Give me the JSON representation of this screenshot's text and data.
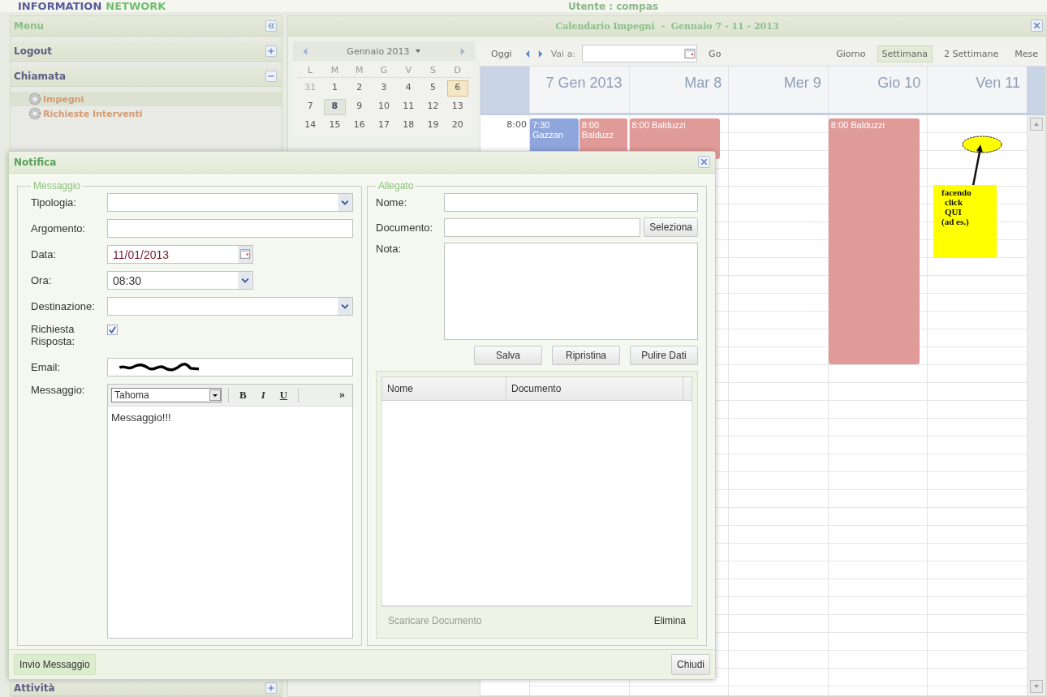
{
  "header": {
    "brand": "INFORMATION",
    "brand_accent": "NETWORK",
    "user": "Utente : compas"
  },
  "sidebar": {
    "title": "Menu",
    "sections": [
      {
        "label": "Logout",
        "expanded": false
      },
      {
        "label": "Chiamata",
        "expanded": true,
        "items": [
          {
            "label": "Impegni",
            "selected": true
          },
          {
            "label": "Richieste Interventi",
            "selected": false
          }
        ]
      }
    ],
    "bottom_section": {
      "label": "Attività",
      "expanded": false
    }
  },
  "calendar": {
    "title": "Calendario Impegni  -  Gennaio 7 - 11 - 2013",
    "mini": {
      "month": "Gennaio 2013",
      "weekdays": [
        "L",
        "M",
        "M",
        "G",
        "V",
        "S",
        "D"
      ],
      "weeks": [
        [
          {
            "d": "31",
            "muted": true,
            "today": false,
            "selected": false
          },
          {
            "d": "1",
            "muted": false,
            "today": false,
            "selected": false
          },
          {
            "d": "2",
            "muted": false,
            "today": false,
            "selected": false
          },
          {
            "d": "3",
            "muted": false,
            "today": false,
            "selected": false
          },
          {
            "d": "4",
            "muted": false,
            "today": false,
            "selected": false
          },
          {
            "d": "5",
            "muted": false,
            "today": false,
            "selected": false
          },
          {
            "d": "6",
            "muted": false,
            "today": true,
            "selected": false
          }
        ],
        [
          {
            "d": "7",
            "muted": false,
            "today": false,
            "selected": false
          },
          {
            "d": "8",
            "muted": false,
            "today": false,
            "selected": true
          },
          {
            "d": "9",
            "muted": false,
            "today": false,
            "selected": false
          },
          {
            "d": "10",
            "muted": false,
            "today": false,
            "selected": false
          },
          {
            "d": "11",
            "muted": false,
            "today": false,
            "selected": false
          },
          {
            "d": "12",
            "muted": false,
            "today": false,
            "selected": false
          },
          {
            "d": "13",
            "muted": false,
            "today": false,
            "selected": false
          }
        ],
        [
          {
            "d": "14",
            "muted": false,
            "today": false,
            "selected": false
          },
          {
            "d": "15",
            "muted": false,
            "today": false,
            "selected": false
          },
          {
            "d": "16",
            "muted": false,
            "today": false,
            "selected": false
          },
          {
            "d": "17",
            "muted": false,
            "today": false,
            "selected": false
          },
          {
            "d": "18",
            "muted": false,
            "today": false,
            "selected": false
          },
          {
            "d": "19",
            "muted": false,
            "today": false,
            "selected": false
          },
          {
            "d": "20",
            "muted": false,
            "today": false,
            "selected": false
          }
        ]
      ]
    },
    "toolbar": {
      "today": "Oggi",
      "goto": "Vai a:",
      "go": "Go",
      "views": [
        {
          "label": "Giorno",
          "selected": false
        },
        {
          "label": "Settimana",
          "selected": true
        },
        {
          "label": "2 Settimane",
          "selected": false
        },
        {
          "label": "Mese",
          "selected": false
        }
      ]
    },
    "time_label": "8:00",
    "days": [
      {
        "label": "7 Gen 2013",
        "events": [
          {
            "time": "7:30",
            "title": "Gazzan",
            "color": "#8fa6dd",
            "kind": "short"
          },
          {
            "time": "8:00",
            "title": "Balduzz",
            "color": "#e09a98",
            "kind": "short"
          }
        ]
      },
      {
        "label": "Mar 8",
        "events": [
          {
            "time": "8:00",
            "title": "Balduzzi",
            "color": "#e09a98",
            "kind": "short"
          }
        ]
      },
      {
        "label": "Mer 9"
      },
      {
        "label": "Gio 10",
        "events": [
          {
            "time": "8:00",
            "title": "Balduzzi",
            "color": "#e09a98",
            "kind": "long"
          }
        ]
      },
      {
        "label": "Ven 11"
      }
    ],
    "annotation": {
      "lines": [
        "facendo",
        "click",
        "QUI",
        "(ad es.)"
      ]
    }
  },
  "dialog": {
    "title": "Notifica",
    "message": {
      "legend": "Messaggio",
      "fields": [
        {
          "kind": "select",
          "label": "Tipologia:"
        },
        {
          "kind": "text",
          "label": "Argomento:"
        },
        {
          "kind": "date",
          "label": "Data:",
          "value": "11/01/2013"
        },
        {
          "kind": "time",
          "label": "Ora:",
          "value": "08:30"
        },
        {
          "kind": "select",
          "label": "Destinazione:"
        },
        {
          "kind": "checkbox",
          "label": "Richiesta Risposta:",
          "checked": true
        },
        {
          "kind": "redacted",
          "label": "Email:"
        },
        {
          "kind": "editor",
          "label": "Messaggio:",
          "font": "Tahoma",
          "tools": [
            {
              "kind": "bold",
              "label": "B"
            },
            {
              "kind": "italic",
              "label": "I"
            },
            {
              "kind": "underline",
              "label": "U"
            },
            {
              "kind": "more",
              "label": "»"
            }
          ],
          "value": "Messaggio!!!"
        }
      ]
    },
    "attachment": {
      "legend": "Allegato",
      "fields": [
        {
          "kind": "text",
          "label": "Nome:"
        },
        {
          "kind": "file",
          "label": "Documento:",
          "button": "Seleziona"
        },
        {
          "kind": "textarea",
          "label": "Nota:"
        }
      ],
      "buttons": [
        "Salva",
        "Ripristina",
        "Pulire Dati"
      ],
      "grid": {
        "columns": [
          "Nome",
          "Documento"
        ],
        "download": "Scaricare Documento",
        "download_disabled": true,
        "delete": "Elimina"
      }
    },
    "footer": [
      {
        "label": "Invio Messaggio",
        "highlighted": true
      },
      {
        "label": "Chiudi",
        "highlighted": false
      }
    ]
  }
}
